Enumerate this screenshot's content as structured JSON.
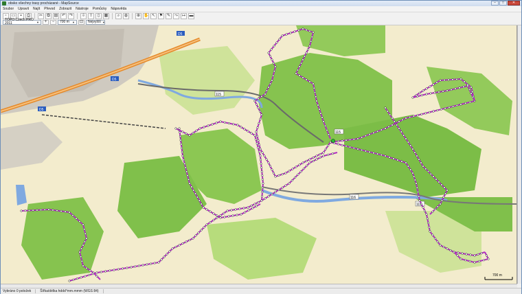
{
  "window": {
    "title": "obsko všechny trasy procházané - MapSource",
    "minimize": "–",
    "maximize": "□",
    "close": "✕"
  },
  "menu": [
    "Soubor",
    "Upravit",
    "Najít",
    "Převod",
    "Zobrazit",
    "Nástroje",
    "Pomůcky",
    "Nápověda"
  ],
  "toolbar": {
    "map_product": "TOPO Czech PRO 2011",
    "zoom_value": "700 m",
    "detail_value": "Nejvyšší"
  },
  "map": {
    "road_labels": [
      "D5",
      "D5",
      "D5",
      "115",
      "115",
      "116",
      "115"
    ],
    "scale_text": "700 m",
    "colors": {
      "forest": "#7fc24a",
      "forest_light": "#b7dc7c",
      "field": "#f3eccd",
      "urban": "#c9c9c9",
      "water": "#7fa9e0",
      "track": "#b22ec2",
      "highway": "#e58a2b"
    }
  },
  "status": {
    "selection": "Vybráno 0 položek",
    "coords": "Šířka/délka hddd°mm.mmm (WGS 84)"
  }
}
